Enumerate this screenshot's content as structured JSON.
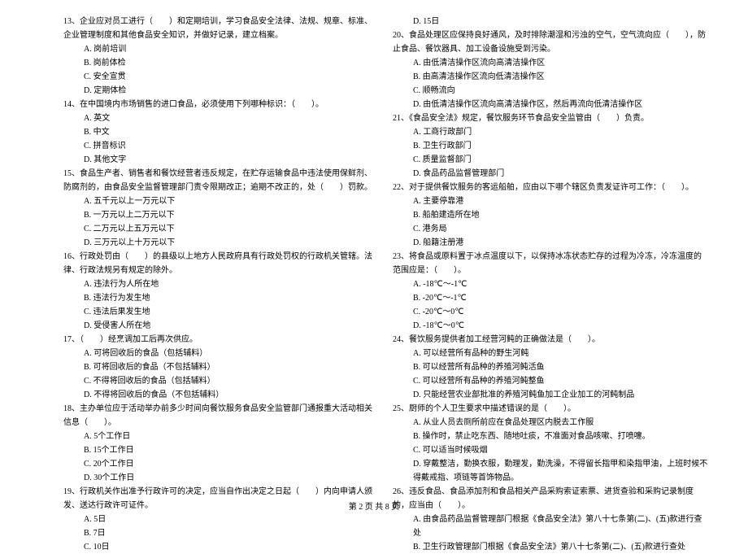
{
  "left": {
    "q13": "13、企业应对员工进行（　　）和定期培训，学习食品安全法律、法规、规章、标准、企业管理制度和其他食品安全知识，并做好记录，建立档案。",
    "q13a": "A. 岗前培训",
    "q13b": "B. 岗前体检",
    "q13c": "C. 安全宣贯",
    "q13d": "D. 定期体检",
    "q14": "14、在中国境内市场销售的进口食品，必须使用下列哪种标识：（　　）。",
    "q14a": "A. 英文",
    "q14b": "B. 中文",
    "q14c": "C. 拼音标识",
    "q14d": "D. 其他文字",
    "q15": "15、食品生产者、销售者和餐饮经营者违反规定，在贮存运输食品中违法使用保鲜剂、防腐剂的，由食品安全监督管理部门责令限期改正；逾期不改正的，处（　　）罚款。",
    "q15a": "A. 五千元以上一万元以下",
    "q15b": "B. 一万元以上二万元以下",
    "q15c": "C. 二万元以上五万元以下",
    "q15d": "D. 三万元以上十万元以下",
    "q16": "16、行政处罚由（　　）的县级以上地方人民政府具有行政处罚权的行政机关管辖。法律、行政法规另有规定的除外。",
    "q16a": "A. 违法行为人所在地",
    "q16b": "B. 违法行为发生地",
    "q16c": "C. 违法后果发生地",
    "q16d": "D. 受侵害人所在地",
    "q17": "17、（　　）经烹调加工后再次供应。",
    "q17a": "A. 可将回收后的食品（包括辅料）",
    "q17b": "B. 可将回收后的食品（不包括辅料）",
    "q17c": "C. 不得将回收后的食品（包括辅料）",
    "q17d": "D. 不得将回收后的食品（不包括辅料）",
    "q18": "18、主办单位应于活动举办前多少时间向餐饮服务食品安全监管部门通报重大活动相关信息（　　）。",
    "q18a": "A. 5个工作日",
    "q18b": "B. 15个工作日",
    "q18c": "C. 20个工作日",
    "q18d": "D. 30个工作日",
    "q19": "19、行政机关作出准予行政许可的决定，应当自作出决定之日起（　　）内向申请人颁发、送达行政许可证件。",
    "q19a": "A. 5日",
    "q19b": "B. 7日",
    "q19c": "C. 10日"
  },
  "right": {
    "q19d": "D. 15日",
    "q20": "20、食品处理区应保持良好通风，及时排除潮湿和污浊的空气，空气流向应（　　），防止食品、餐饮器具、加工设备设施受到污染。",
    "q20a": "A. 由低清洁操作区流向高清洁操作区",
    "q20b": "B. 由高清洁操作区流向低清洁操作区",
    "q20c": "C. 顺畅流向",
    "q20d": "D. 由低清洁操作区流向高清洁操作区，然后再流向低清洁操作区",
    "q21": "21、《食品安全法》规定，餐饮服务环节食品安全监管由（　　）负责。",
    "q21a": "A. 工商行政部门",
    "q21b": "B. 卫生行政部门",
    "q21c": "C. 质量监督部门",
    "q21d": "D. 食品药品监督管理部门",
    "q22": "22、对于提供餐饮服务的客运船舶，应由以下哪个辖区负责发证许可工作：（　　）。",
    "q22a": "A. 主要停靠港",
    "q22b": "B. 船舶建造所在地",
    "q22c": "C. 港务局",
    "q22d": "D. 船籍注册港",
    "q23": "23、将食品或原料置于冰点温度以下，以保持冰冻状态贮存的过程为冷冻，冷冻温度的范围应是：（　　）。",
    "q23a": "A. -18℃～-1℃",
    "q23b": "B. -20℃～-1℃",
    "q23c": "C. -20℃～0℃",
    "q23d": "D. -18℃～0℃",
    "q24": "24、餐饮服务提供者加工经营河鲀的正确做法是（　　）。",
    "q24a": "A. 可以经营所有品种的野生河鲀",
    "q24b": "B. 可以经营所有品种的养殖河鲀活鱼",
    "q24c": "C. 可以经营所有品种的养殖河鲀整鱼",
    "q24d": "D. 只能经营农业部批准的养殖河鲀鱼加工企业加工的河鲀制品",
    "q25": "25、厨师的个人卫生要求中描述错误的是（　　）。",
    "q25a": "A. 从业人员去厕所前应在食品处理区内脱去工作服",
    "q25b": "B. 操作时，禁止吃东西、随地吐痰，不准面对食品咳嗽、打喷嚏。",
    "q25c": "C. 可以适当时候吸烟",
    "q25d": "D. 穿戴整洁，勤换衣服，勤理发，勤洗澡，不得留长指甲和染指甲油，上班时候不得戴戒指、项链等首饰物品。",
    "q26": "26、违反食品、食品添加剂和食品相关产品采购索证索票、进货查验和采购记录制度的，应当由（　　）。",
    "q26a": "A. 由食品药品监督管理部门根据《食品安全法》第八十七条第(二)、(五)款进行查处",
    "q26b": "B. 卫生行政管理部门根据《食品安全法》第八十七条第(二)、(五)款进行查处"
  },
  "footer": "第 2 页 共 8 页"
}
